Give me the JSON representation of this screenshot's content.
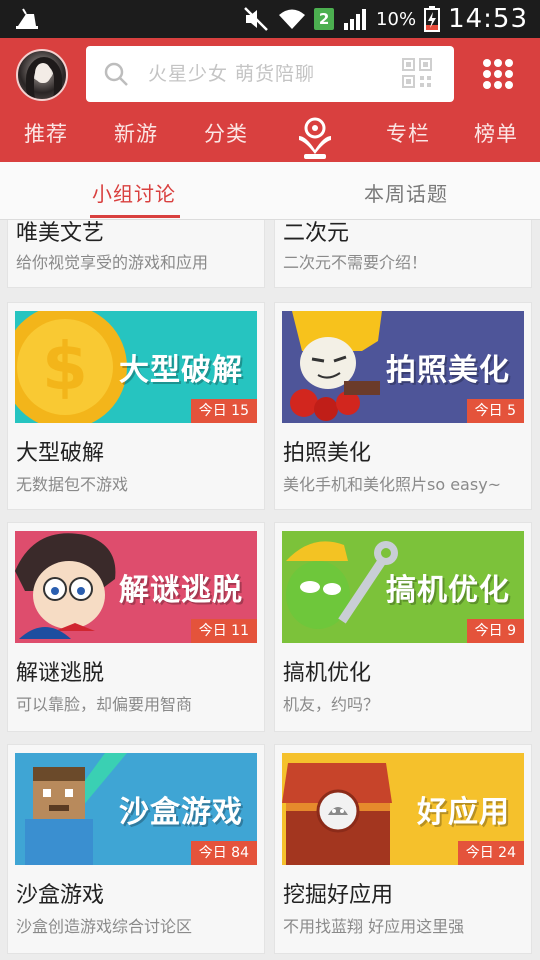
{
  "status_bar": {
    "badge": "2",
    "battery": "10%",
    "time": "14:53"
  },
  "header": {
    "search_placeholder": "火星少女 萌货陪聊",
    "tabs": [
      "推荐",
      "新游",
      "分类",
      "专栏",
      "榜单"
    ]
  },
  "subtabs": {
    "active": "小组讨论",
    "inactive": "本周话题"
  },
  "cards": [
    {
      "title": "唯美文艺",
      "desc": "给你视觉享受的游戏和应用"
    },
    {
      "title": "二次元",
      "desc": "二次元不需要介绍！"
    },
    {
      "title": "大型破解",
      "desc": "无数据包不游戏",
      "banner_text": "大型破解",
      "badge": "今日 15",
      "bg": "#26c4c0"
    },
    {
      "title": "拍照美化",
      "desc": "美化手机和美化照片so easy~",
      "banner_text": "拍照美化",
      "badge": "今日 5",
      "bg": "#4e5599"
    },
    {
      "title": "解谜逃脱",
      "desc": "可以靠脸，却偏要用智商",
      "banner_text": "解谜逃脱",
      "badge": "今日 11",
      "bg": "#de4d6d"
    },
    {
      "title": "搞机优化",
      "desc": "机友，约吗？",
      "banner_text": "搞机优化",
      "badge": "今日 9",
      "bg": "#7cc23a"
    },
    {
      "title": "沙盒游戏",
      "desc": "沙盒创造游戏综合讨论区",
      "banner_text": "沙盒游戏",
      "badge": "今日 84",
      "bg": "#3fa5d4"
    },
    {
      "title": "挖掘好应用",
      "desc": "不用找蓝翔 好应用这里强",
      "banner_text": "好应用",
      "badge": "今日 24",
      "bg": "#f5c12c"
    }
  ]
}
